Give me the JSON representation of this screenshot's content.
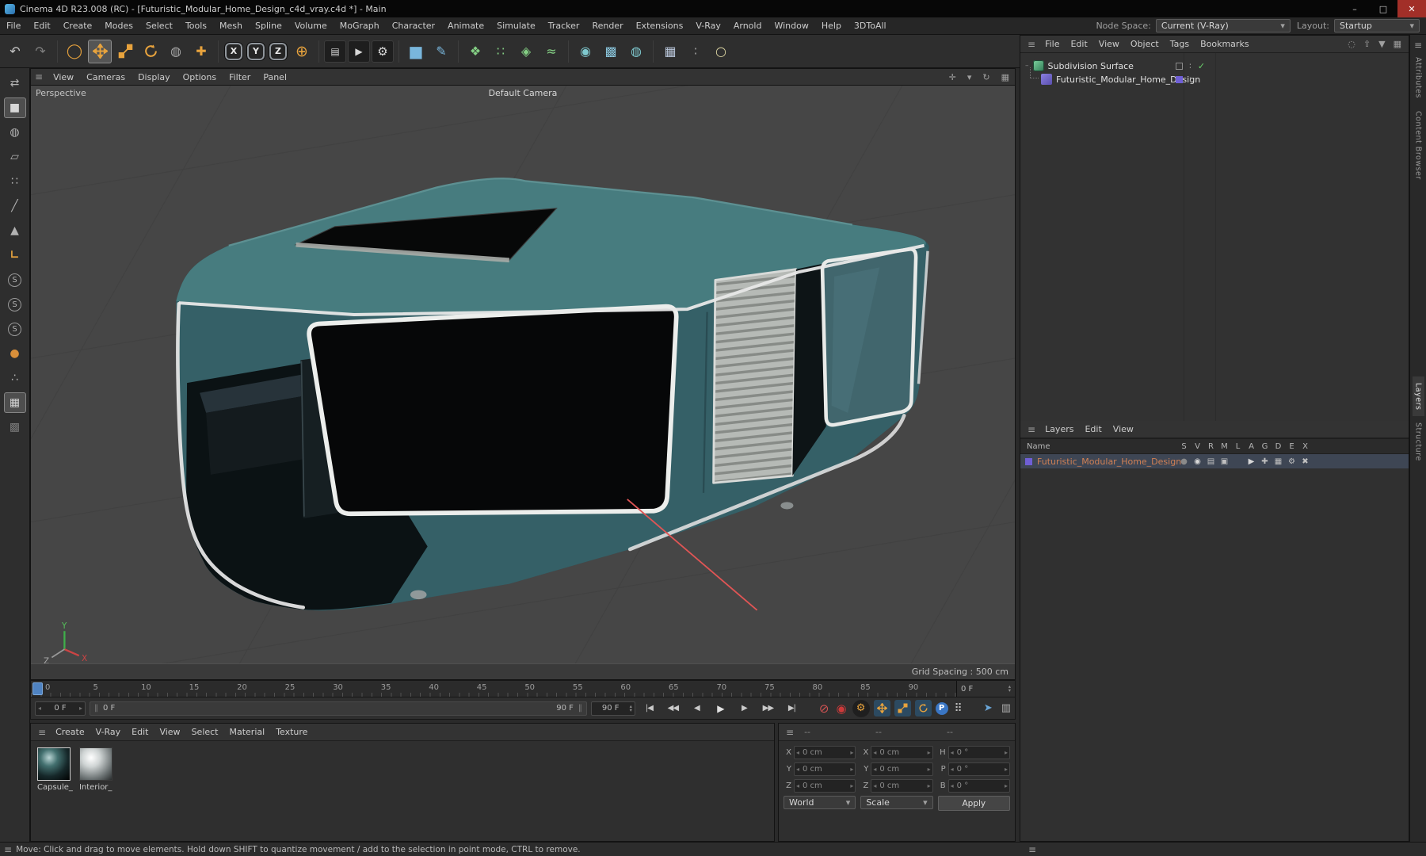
{
  "window": {
    "title": "Cinema 4D R23.008 (RC) - [Futuristic_Modular_Home_Design_c4d_vray.c4d *] - Main",
    "minimize": "–",
    "maximize": "□",
    "close": "✕"
  },
  "icons": {
    "hamburger": "≡",
    "dropdown": "▾",
    "spin_left": "◂",
    "spin_right": "▸",
    "spin_up": "▴",
    "spin_down": "▾",
    "grip": "‖",
    "check": "✓",
    "toggle_dots": "∶",
    "search": "◌",
    "arrow_up": "⇧",
    "filter": "▼",
    "grid": "▦",
    "pan": "✛",
    "refresh": "↻"
  },
  "menubar": {
    "items": [
      "File",
      "Edit",
      "Create",
      "Modes",
      "Select",
      "Tools",
      "Mesh",
      "Spline",
      "Volume",
      "MoGraph",
      "Character",
      "Animate",
      "Simulate",
      "Tracker",
      "Render",
      "Extensions",
      "V-Ray",
      "Arnold",
      "Window",
      "Help",
      "3DToAll"
    ],
    "node_space_label": "Node Space:",
    "node_space_value": "Current (V-Ray)",
    "layout_label": "Layout:",
    "layout_value": "Startup"
  },
  "toolbar": {
    "icons": [
      {
        "name": "undo-icon",
        "glyph": "↶",
        "color": "#c4c4c4"
      },
      {
        "name": "redo-icon",
        "glyph": "↷",
        "color": "#7f7f7f"
      },
      {
        "name": "live-selection-icon",
        "glyph": "◯",
        "color": "#e8a33d"
      },
      {
        "name": "last-tool-icon",
        "glyph": "◍",
        "color": "#a8a8a8"
      },
      {
        "name": "add-tool-icon",
        "glyph": "✚",
        "color": "#e8a33d"
      },
      {
        "name": "x-axis-lock",
        "glyph": "X",
        "color": "#e6e6e6"
      },
      {
        "name": "y-axis-lock",
        "glyph": "Y",
        "color": "#e6e6e6"
      },
      {
        "name": "z-axis-lock",
        "glyph": "Z",
        "color": "#e6e6e6"
      },
      {
        "name": "coordinate-system-icon",
        "glyph": "⊕",
        "color": "#e8a33d"
      },
      {
        "name": "render-view-icon",
        "glyph": "▤",
        "color": "#d8d8d8"
      },
      {
        "name": "render-picture-viewer-icon",
        "glyph": "▶",
        "color": "#d8d8d8"
      },
      {
        "name": "render-settings-icon",
        "glyph": "⚙",
        "color": "#d8d8d8"
      },
      {
        "name": "add-cube-icon",
        "glyph": "■",
        "color": "#79b6dc"
      },
      {
        "name": "spline-pen-icon",
        "glyph": "✎",
        "color": "#79b6dc"
      },
      {
        "name": "mograph-cloner-icon",
        "glyph": "❖",
        "color": "#84cf84"
      },
      {
        "name": "mograph-matrix-icon",
        "glyph": "∷",
        "color": "#84cf84"
      },
      {
        "name": "mograph-fracture-icon",
        "glyph": "◈",
        "color": "#84cf84"
      },
      {
        "name": "fields-icon",
        "glyph": "≈",
        "color": "#84cf84"
      },
      {
        "name": "deformer-icon",
        "glyph": "◉",
        "color": "#7fc9cf"
      },
      {
        "name": "volume-icon",
        "glyph": "▩",
        "color": "#8cc9e0"
      },
      {
        "name": "simulate-icon",
        "glyph": "◍",
        "color": "#7fc9cf"
      },
      {
        "name": "snap-icon",
        "glyph": "▦",
        "color": "#b9c6da"
      },
      {
        "name": "dots-icon",
        "glyph": "∶",
        "color": "#9a9a9a"
      },
      {
        "name": "light-icon",
        "glyph": "○",
        "color": "#d9d2a0"
      }
    ]
  },
  "palette": {
    "tools": [
      {
        "name": "make-editable-icon",
        "glyph": "⇄"
      },
      {
        "name": "model-mode-icon",
        "glyph": "■"
      },
      {
        "name": "texture-mode-icon",
        "glyph": "◍"
      },
      {
        "name": "workplane-mode-icon",
        "glyph": "▱"
      },
      {
        "name": "points-mode-icon",
        "glyph": "∷"
      },
      {
        "name": "edges-mode-icon",
        "glyph": "╱"
      },
      {
        "name": "polygons-mode-icon",
        "glyph": "▲"
      },
      {
        "name": "axis-mode-icon",
        "glyph": "∟"
      },
      {
        "name": "solo-off-icon",
        "glyph": "S"
      },
      {
        "name": "solo-single-icon",
        "glyph": "S"
      },
      {
        "name": "solo-hierarchy-icon",
        "glyph": "S"
      },
      {
        "name": "snap-toggle-icon",
        "glyph": "●"
      },
      {
        "name": "snap-settings-icon",
        "glyph": "∴"
      },
      {
        "name": "quantize-grid-icon",
        "glyph": "▦"
      },
      {
        "name": "workplane-lock-icon",
        "glyph": "▩"
      }
    ]
  },
  "viewport": {
    "menu_items": [
      "View",
      "Cameras",
      "Display",
      "Options",
      "Filter",
      "Panel"
    ],
    "view_label": "Perspective",
    "camera_label": "Default Camera",
    "grid_spacing_label": "Grid Spacing : 500 cm",
    "model_color": "#3a6b70"
  },
  "timeline": {
    "ticks": [
      "0",
      "5",
      "10",
      "15",
      "20",
      "25",
      "30",
      "35",
      "40",
      "45",
      "50",
      "55",
      "60",
      "65",
      "70",
      "75",
      "80",
      "85",
      "90"
    ],
    "ruler_frame_value": "0 F",
    "start_box_value": "0 F",
    "range_start_label": "0 F",
    "range_end_label": "90 F",
    "end_box_value": "90 F",
    "transport": [
      {
        "name": "goto-start-button",
        "glyph": "|◀"
      },
      {
        "name": "prev-key-button",
        "glyph": "◀◀"
      },
      {
        "name": "prev-frame-button",
        "glyph": "◀"
      },
      {
        "name": "play-button",
        "glyph": "▶"
      },
      {
        "name": "next-frame-button",
        "glyph": "▶"
      },
      {
        "name": "next-key-button",
        "glyph": "▶▶"
      },
      {
        "name": "goto-end-button",
        "glyph": "▶|"
      }
    ],
    "keys": {
      "record": "⊘",
      "autokey": "◉",
      "gear": "⚙",
      "param": "P",
      "pla": "⠿",
      "cursor": "➤",
      "columns": "▥"
    }
  },
  "materials": {
    "menu_items": [
      "Create",
      "V-Ray",
      "Edit",
      "View",
      "Select",
      "Material",
      "Texture"
    ],
    "items": [
      {
        "label": "Capsule_"
      },
      {
        "label": "Interior_"
      }
    ]
  },
  "coordinates": {
    "headers": [
      "--",
      "--",
      "--"
    ],
    "position": [
      {
        "label": "X",
        "value": "0 cm"
      },
      {
        "label": "Y",
        "value": "0 cm"
      },
      {
        "label": "Z",
        "value": "0 cm"
      }
    ],
    "size": [
      {
        "label": "X",
        "value": "0 cm"
      },
      {
        "label": "Y",
        "value": "0 cm"
      },
      {
        "label": "Z",
        "value": "0 cm"
      }
    ],
    "rotation": [
      {
        "label": "H",
        "value": "0 °"
      },
      {
        "label": "P",
        "value": "0 °"
      },
      {
        "label": "B",
        "value": "0 °"
      }
    ],
    "space_dropdown": "World",
    "scale_dropdown": "Scale",
    "apply_label": "Apply"
  },
  "object_manager": {
    "menu_items": [
      "File",
      "Edit",
      "View",
      "Object",
      "Tags",
      "Bookmarks"
    ],
    "objects": [
      {
        "name": "Subdivision Surface"
      },
      {
        "name": "Futuristic_Modular_Home_Design"
      }
    ]
  },
  "layers_panel": {
    "menu_items": [
      "Layers",
      "Edit",
      "View"
    ],
    "name_header": "Name",
    "columns": [
      "S",
      "V",
      "R",
      "M",
      "L",
      "A",
      "G",
      "D",
      "E",
      "X"
    ],
    "icon_glyphs": [
      "●",
      "◉",
      "▤",
      "▣",
      "",
      "▶",
      "✚",
      "▦",
      "⚙",
      "✖"
    ],
    "rows": [
      {
        "name": "Futuristic_Modular_Home_Design",
        "color": "#6f5fd6"
      }
    ]
  },
  "side_tabs": [
    {
      "label": "Attributes"
    },
    {
      "label": "Content Browser"
    },
    {
      "label": "Layers"
    },
    {
      "label": "Structure"
    }
  ],
  "statusbar": {
    "message": "Move: Click and drag to move elements. Hold down SHIFT to quantize movement / add to the selection in point mode, CTRL to remove."
  },
  "colors": {
    "accent_orange": "#e8a33d",
    "model_teal": "#3a6b70",
    "playhead_blue": "#4f83c2",
    "layer_purple": "#6f5fd6"
  }
}
